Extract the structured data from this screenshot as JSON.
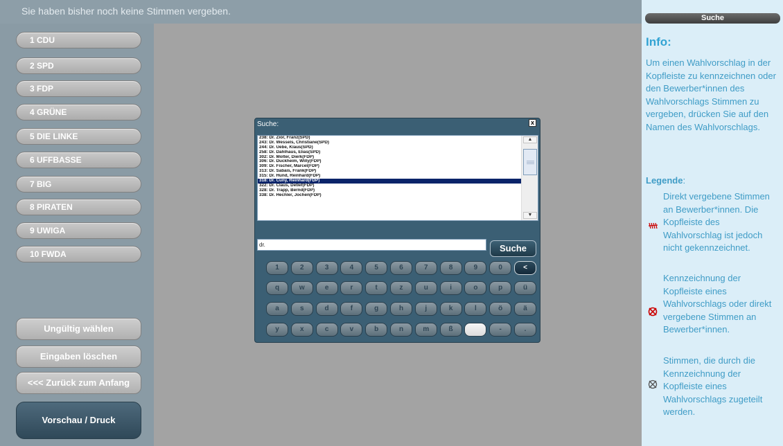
{
  "status_message": "Sie haben bisher noch keine Stimmen vergeben.",
  "parties": [
    {
      "label": "1 CDU"
    },
    {
      "label": "2 SPD"
    },
    {
      "label": "3 FDP"
    },
    {
      "label": "4 GRÜNE"
    },
    {
      "label": "5 DIE LINKE"
    },
    {
      "label": "6 UFFBASSE"
    },
    {
      "label": "7 BIG"
    },
    {
      "label": "8 PIRATEN"
    },
    {
      "label": "9 UWIGA"
    },
    {
      "label": "10 FWDA"
    }
  ],
  "actions": {
    "invalid": "Ungültig wählen",
    "clear": "Eingaben löschen",
    "back": "<<< Zurück zum Anfang",
    "preview": "Vorschau / Druck"
  },
  "search_tab": "Suche",
  "info": {
    "title": "Info:",
    "description": "Um einen Wahlvorschlag in der Kopfleiste zu kennzeichnen oder den Bewerber*innen des Wahlvorschlags Stimmen zu vergeben, drücken Sie auf den Namen des Wahlvorschlags.",
    "legend_title": "Legende",
    "legend_suffix": ":",
    "legend": [
      {
        "icon": "red-tally-marks-icon",
        "text": "Direkt vergebene Stimmen an Bewerber*innen. Die Kopfleiste des Wahlvorschlag ist jedoch nicht gekennzeichnet."
      },
      {
        "icon": "red-crossed-circle-icon",
        "text": "Kennzeichnung der Kopfleiste eines Wahlvorschlags oder direkt vergebene Stimmen an Bewerber*innen."
      },
      {
        "icon": "gray-crossed-circle-icon",
        "text": "Stimmen, die durch die Kennzeichnung der Kopfleiste eines Wahlvorschlags zugeteilt werden."
      }
    ]
  },
  "dialog": {
    "title": "Suche:",
    "close": "x",
    "results": [
      "238: Dr. Zior, Franz(SPD)",
      "243: Dr. Wessels, Christiane(SPD)",
      "244: Dr. Uebe, Klaus(SPD)",
      "258: Dr. Dahlhaus, Elias(SPD)",
      "302: Dr. Molter, Dierk(FDP)",
      "306: Dr. Duckheim, Willy(FDP)",
      "309: Dr. Fischer, Marcel(FDP)",
      "313: Dr. Sabais, Frank(FDP)",
      "315: Dr. Hund, Reinhard(FDP)",
      "318: Dr. Cuny, Reinhard(FDP)",
      "322: Dr. Claus, Detlef(FDP)",
      "328: Dr. Trapp, Bernd(FDP)",
      "338: Dr. Hechler, Jochen(FDP)"
    ],
    "selected_index": 9,
    "query": "dr.",
    "search_button": "Suche",
    "keyboard": [
      [
        "1",
        "2",
        "3",
        "4",
        "5",
        "6",
        "7",
        "8",
        "9",
        "0",
        "<"
      ],
      [
        "q",
        "w",
        "e",
        "r",
        "t",
        "z",
        "u",
        "i",
        "o",
        "p",
        "ü"
      ],
      [
        "a",
        "s",
        "d",
        "f",
        "g",
        "h",
        "j",
        "k",
        "l",
        "ö",
        "ä"
      ],
      [
        "y",
        "x",
        "c",
        "v",
        "b",
        "n",
        "m",
        "ß",
        " ",
        "-",
        "."
      ]
    ]
  },
  "colors": {
    "sidebar": "#8a9ba5",
    "main_bg": "#a3a3a3",
    "info_bg": "#dbeef8",
    "info_text": "#3f9cc6",
    "dialog_bg": "#3b5f74",
    "selected_row": "#0a246a",
    "legend_red": "#cc0000"
  }
}
